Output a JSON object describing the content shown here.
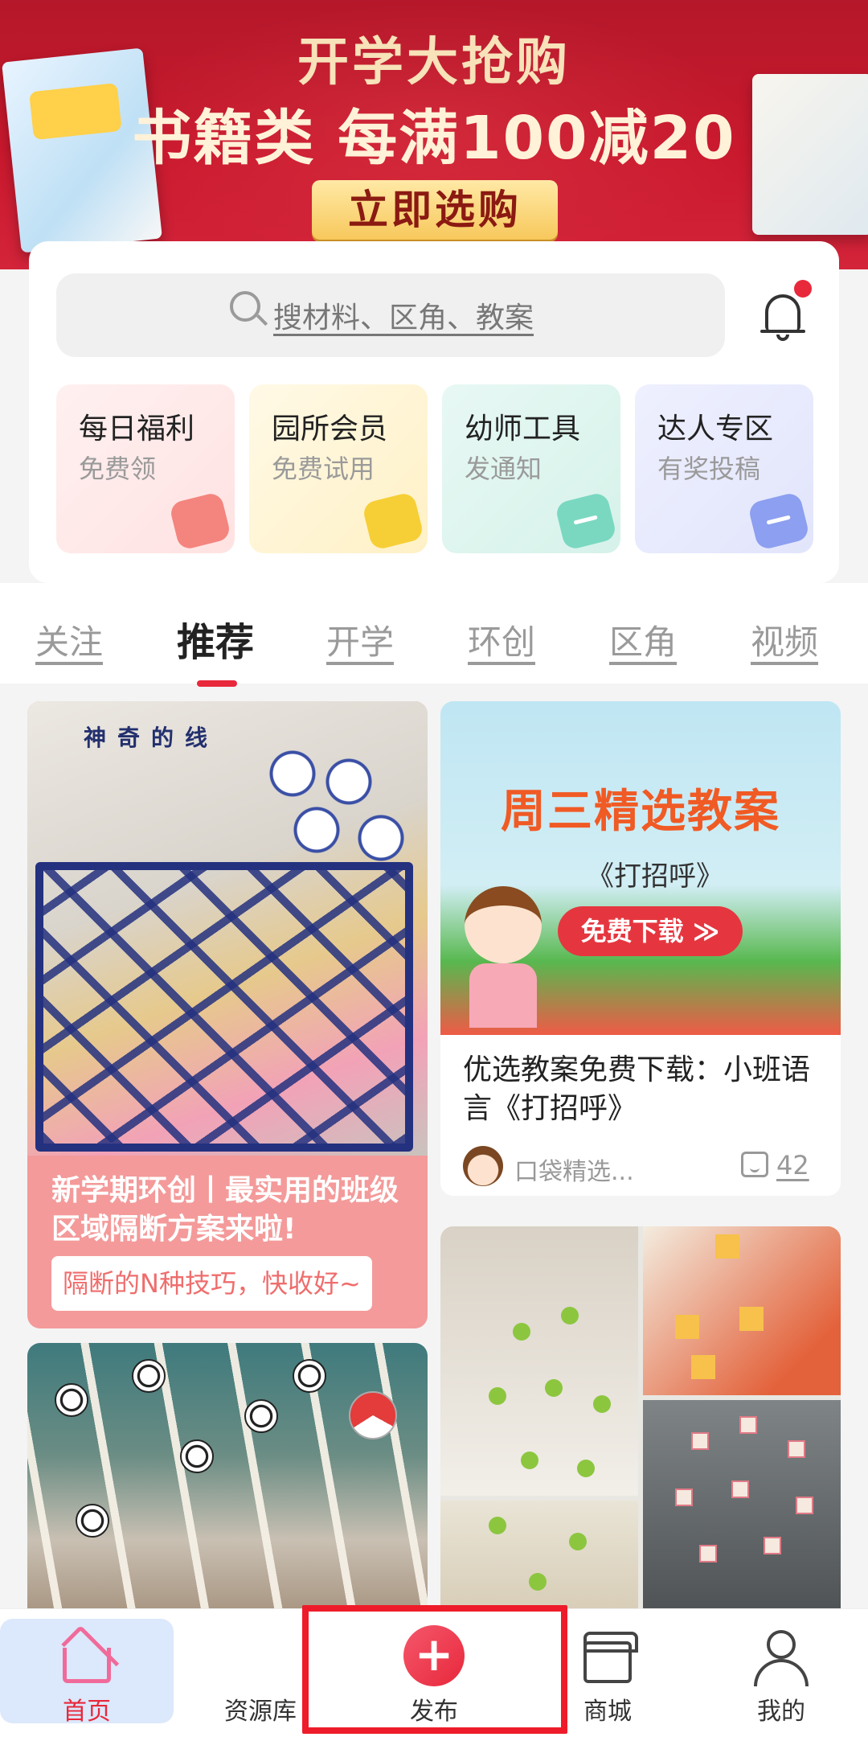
{
  "banner": {
    "line1": "开学大抢购",
    "line2": "书籍类 每满100减20",
    "cta": "立即选购"
  },
  "search": {
    "placeholder": "搜材料、区角、教案"
  },
  "features": [
    {
      "title": "每日福利",
      "subtitle": "免费领"
    },
    {
      "title": "园所会员",
      "subtitle": "免费试用"
    },
    {
      "title": "幼师工具",
      "subtitle": "发通知"
    },
    {
      "title": "达人专区",
      "subtitle": "有奖投稿"
    }
  ],
  "tabs": [
    {
      "label": "关注"
    },
    {
      "label": "推荐"
    },
    {
      "label": "开学"
    },
    {
      "label": "环创"
    },
    {
      "label": "区角"
    },
    {
      "label": "视频"
    }
  ],
  "active_tab": "推荐",
  "feed": {
    "card1": {
      "image_sign": "神奇的线",
      "title": "新学期环创丨最实用的班级区域隔断方案来啦!",
      "tag": "隔断的N种技巧，快收好~"
    },
    "card2": {
      "image_title": "周三精选教案",
      "image_subtitle": "《打招呼》",
      "image_button": "免费下载 ≫",
      "title": "优选教案免费下载：小班语言《打招呼》",
      "author": "口袋精选...",
      "comments": "42"
    }
  },
  "nav": [
    {
      "label": "首页",
      "icon": "home-icon"
    },
    {
      "label": "资源库",
      "icon": "grid-icon"
    },
    {
      "label": "发布",
      "icon": "plus-icon"
    },
    {
      "label": "商城",
      "icon": "shop-icon"
    },
    {
      "label": "我的",
      "icon": "user-icon"
    }
  ],
  "colors": {
    "accent": "#e8283b",
    "banner": "#c9182d",
    "home_active_bg": "#dce8fb"
  }
}
